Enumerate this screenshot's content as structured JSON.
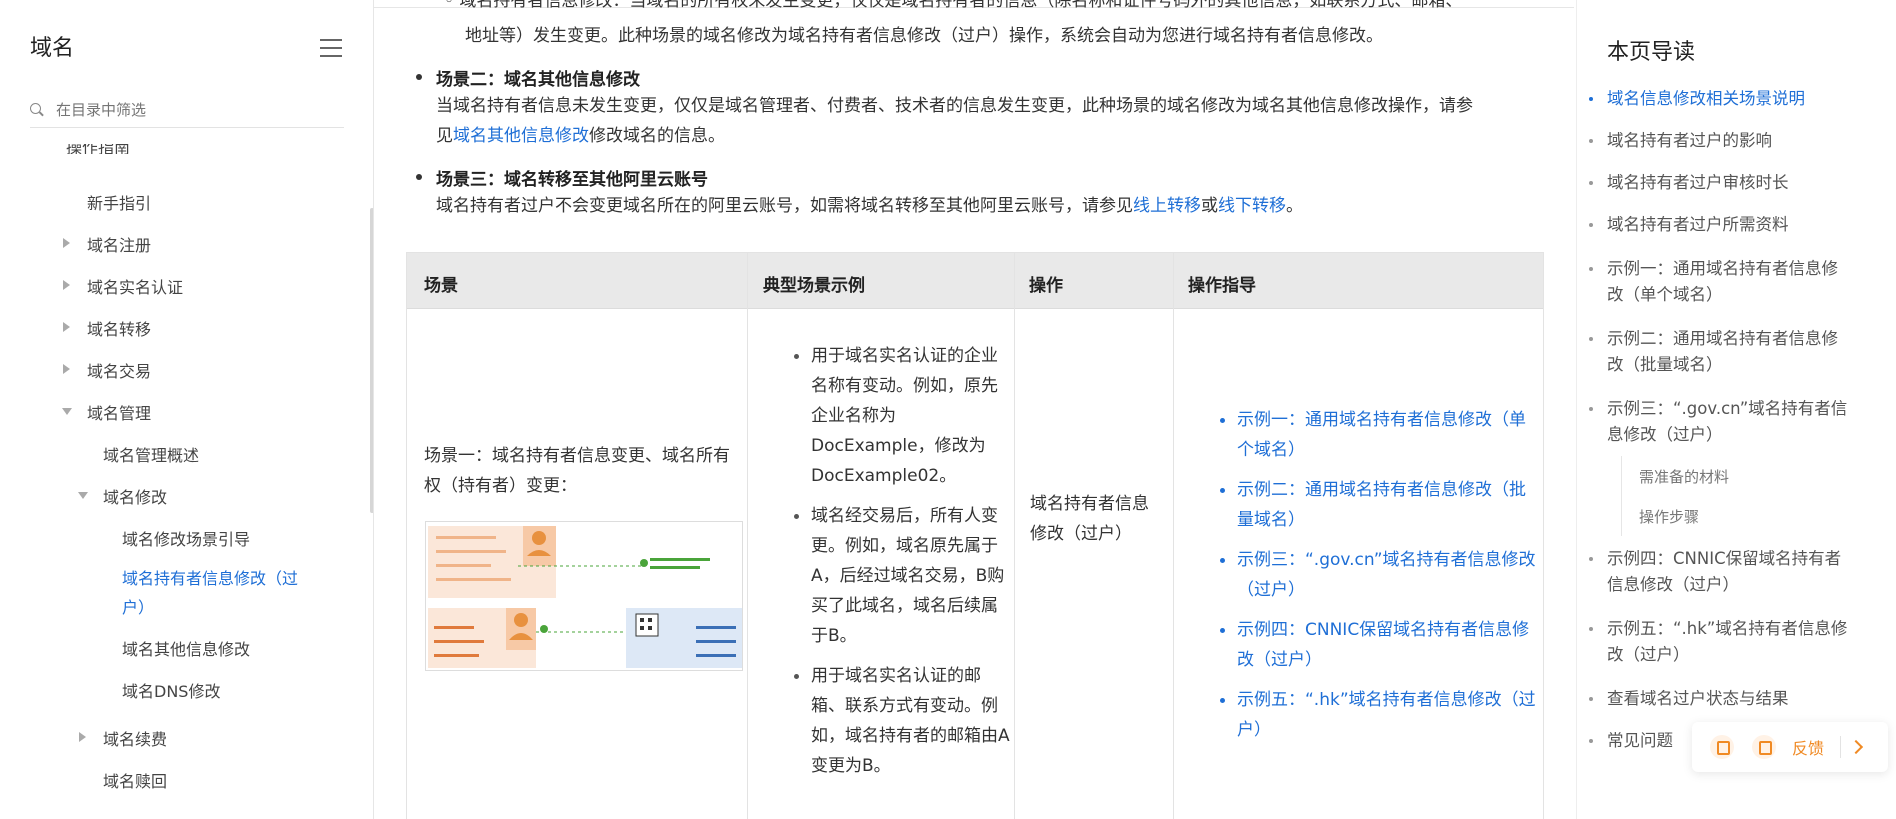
{
  "sidebar": {
    "title": "域名",
    "search_placeholder": "在目录中筛选",
    "items": [
      {
        "label": "操作指南"
      },
      {
        "label": "新手指引"
      },
      {
        "label": "域名注册"
      },
      {
        "label": "域名实名认证"
      },
      {
        "label": "域名转移"
      },
      {
        "label": "域名交易"
      },
      {
        "label": "域名管理"
      },
      {
        "label": "域名管理概述"
      },
      {
        "label": "域名修改"
      },
      {
        "label": "域名修改场景引导"
      },
      {
        "label": "域名持有者信息修改（过户）"
      },
      {
        "label": "域名其他信息修改"
      },
      {
        "label": "域名DNS修改"
      },
      {
        "label": "域名续费"
      },
      {
        "label": "域名赎回"
      }
    ]
  },
  "content": {
    "top_line1": "◦ 域名持有者信息修改：当域名的所有权未发生变更，仅仅是域名持有者的信息（除名称和证件号码外的其他信息，如联系方式、邮箱、",
    "top_line2": "地址等）发生变更。此种场景的域名修改为域名持有者信息修改（过户）操作，系统会自动为您进行域名持有者信息修改。",
    "scene2_title": "场景二：域名其他信息修改",
    "scene2_text1": "当域名持有者信息未发生变更，仅仅是域名管理者、付费者、技术者的信息发生变更，此种场景的域名修改为域名其他信息修改操作，请参",
    "scene2_text2_pre": "见",
    "scene2_link": "域名其他信息修改",
    "scene2_text2_post": "修改域名的信息。",
    "scene3_title": "场景三：域名转移至其他阿里云账号",
    "scene3_text_pre": "域名持有者过户不会变更域名所在的阿里云账号，如需将域名转移至其他阿里云账号，请参见",
    "scene3_link1": "线上转移",
    "scene3_or": "或",
    "scene3_link2": "线下转移",
    "scene3_end": "。"
  },
  "table": {
    "headers": [
      "场景",
      "典型场景示例",
      "操作",
      "操作指导"
    ],
    "scene_text": "场景一：域名持有者信息变更、域名所有权（持有者）变更：",
    "examples": [
      "用于域名实名认证的企业名称有变动。例如，原先企业名称为DocExample，修改为DocExample02。",
      "域名经交易后，所有人变更。例如，域名原先属于A，后经过域名交易，B购买了此域名，域名后续属于B。",
      "用于域名实名认证的邮箱、联系方式有变动。例如，域名持有者的邮箱由A变更为B。"
    ],
    "operation": "域名持有者信息修改（过户）",
    "guides": [
      "示例一：通用域名持有者信息修改（单个域名）",
      "示例二：通用域名持有者信息修改（批量域名）",
      "示例三：“.gov.cn”域名持有者信息修改（过户）",
      "示例四：CNNIC保留域名持有者信息修改（过户）",
      "示例五：“.hk”域名持有者信息修改（过户）"
    ]
  },
  "toc": {
    "title": "本页导读",
    "items": [
      "域名信息修改相关场景说明",
      "域名持有者过户的影响",
      "域名持有者过户审核时长",
      "域名持有者过户所需资料",
      "示例一：通用域名持有者信息修改（单个域名）",
      "示例二：通用域名持有者信息修改（批量域名）",
      "示例三：“.gov.cn”域名持有者信息修改（过户）",
      "需准备的材料",
      "操作步骤",
      "示例四：CNNIC保留域名持有者信息修改（过户）",
      "示例五：“.hk”域名持有者信息修改（过户）",
      "查看域名过户状态与结果",
      "常见问题"
    ]
  },
  "feedback": {
    "label": "反馈"
  },
  "colors": {
    "link": "#1f6fd6",
    "feedback": "#f08a24"
  }
}
